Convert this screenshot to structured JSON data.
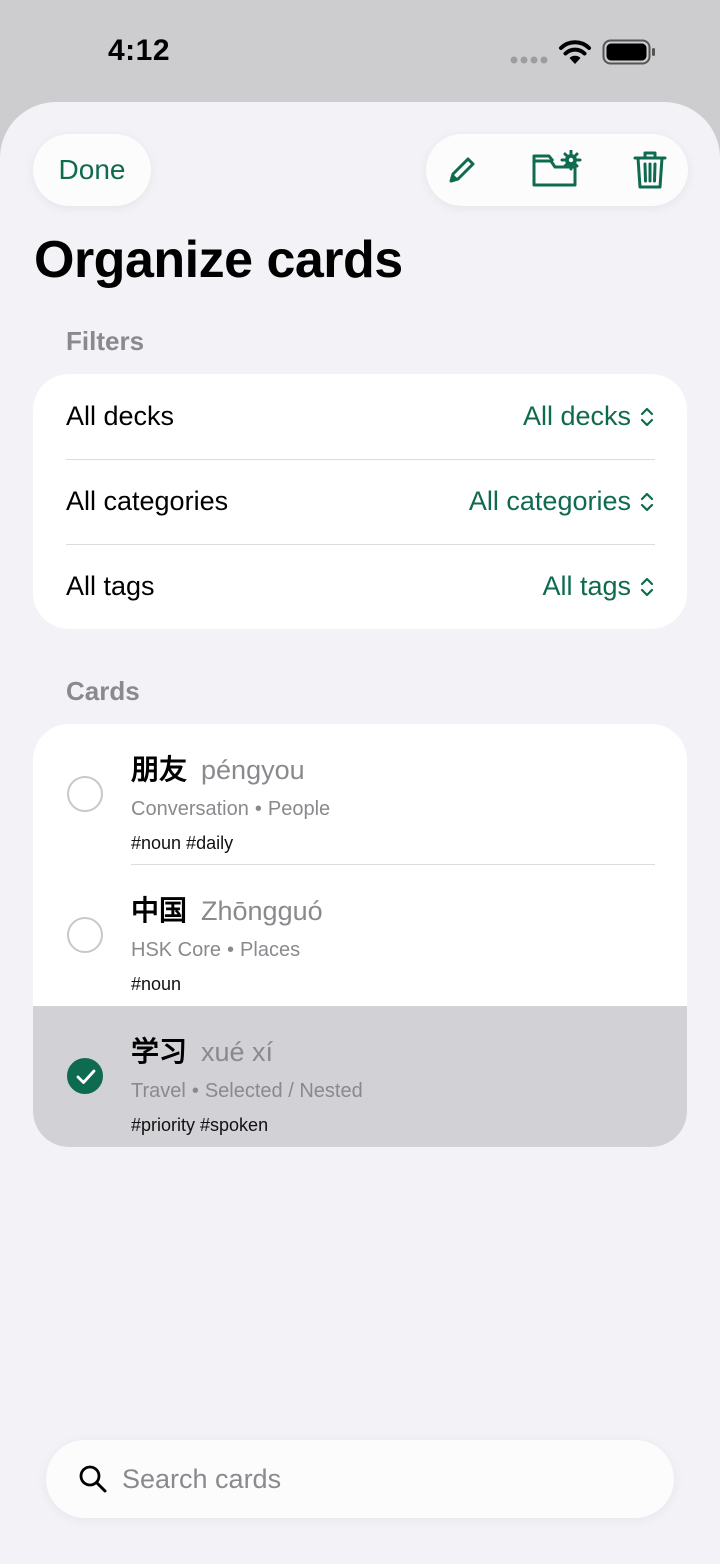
{
  "status": {
    "time": "4:12"
  },
  "header": {
    "done_label": "Done",
    "title": "Organize cards",
    "actions": [
      "pencil-icon",
      "folder-gear-icon",
      "trash-icon"
    ]
  },
  "filters": {
    "section_title": "Filters",
    "rows": [
      {
        "label": "All decks",
        "value": "All decks"
      },
      {
        "label": "All categories",
        "value": "All categories"
      },
      {
        "label": "All tags",
        "value": "All tags"
      }
    ]
  },
  "cards": {
    "section_title": "Cards",
    "items": [
      {
        "hanzi": "朋友",
        "pinyin": "péngyou",
        "deck": "Conversation",
        "category": "People",
        "tags": "#noun #daily",
        "selected": false
      },
      {
        "hanzi": "中国",
        "pinyin": "Zhōngguó",
        "deck": "HSK Core",
        "category": "Places",
        "tags": "#noun",
        "selected": false
      },
      {
        "hanzi": "学习",
        "pinyin": "xué xí",
        "deck": "Travel",
        "category": "Selected / Nested",
        "tags": "#priority #spoken",
        "selected": true
      }
    ]
  },
  "search": {
    "placeholder": "Search cards"
  },
  "colors": {
    "accent": "#0f6b4f",
    "background": "#f2f2f7",
    "selected_row": "#d1d1d6"
  }
}
